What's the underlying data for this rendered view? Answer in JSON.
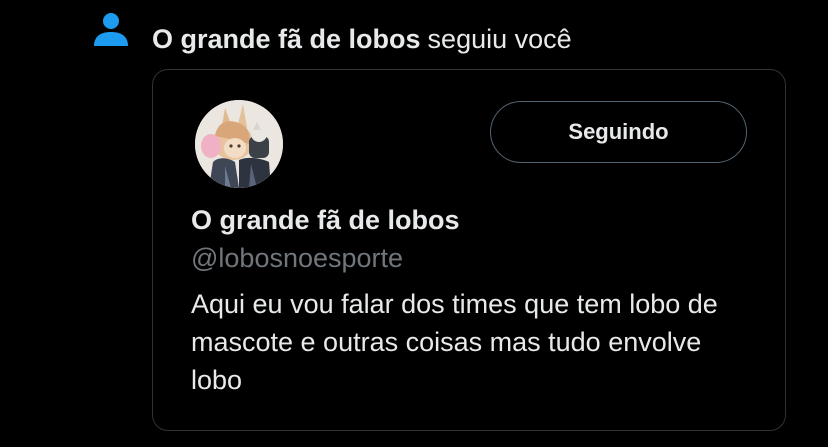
{
  "notification": {
    "icon": "person-icon",
    "follower_name": "O grande fã de lobos",
    "action_text": "seguiu você"
  },
  "profile_card": {
    "display_name": "O grande fã de lobos",
    "handle": "@lobosnoesporte",
    "bio": "Aqui eu vou falar dos times que tem lobo de mascote e outras coisas mas tudo envolve lobo",
    "follow_button_label": "Seguindo"
  },
  "colors": {
    "background": "#000000",
    "text_primary": "#e7e9ea",
    "text_secondary": "#71767b",
    "accent_blue": "#1d9bf0",
    "card_border": "#2f3336"
  }
}
